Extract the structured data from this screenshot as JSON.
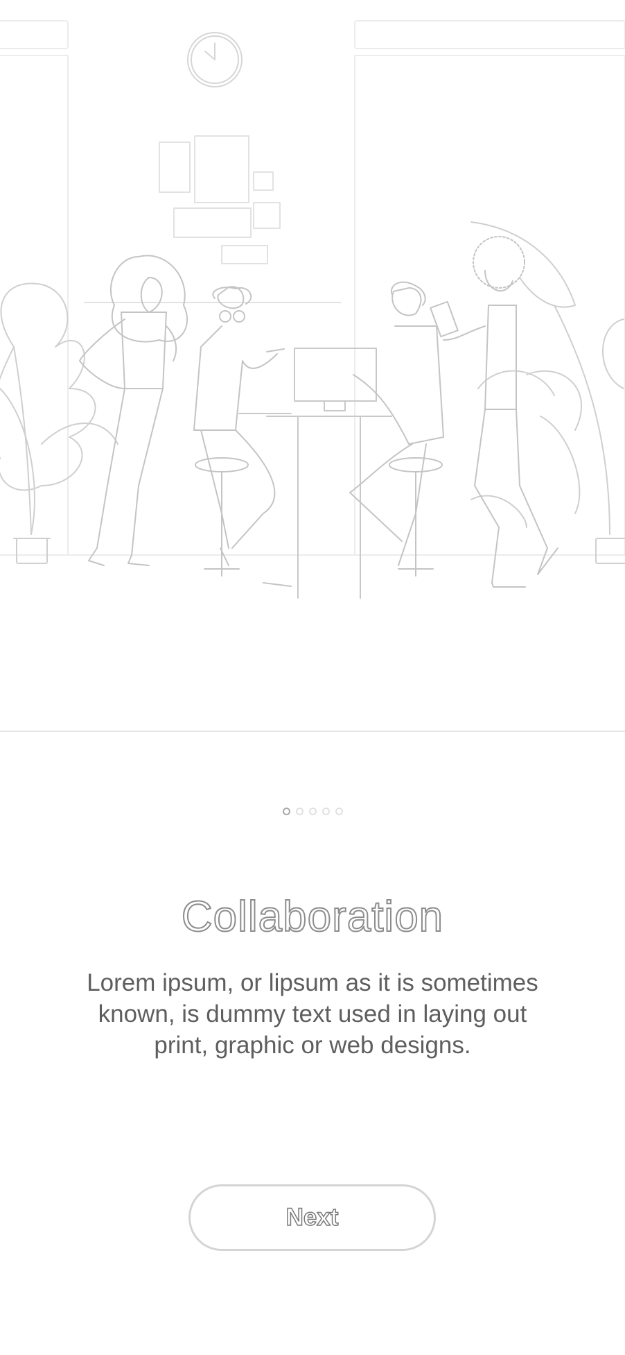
{
  "onboarding": {
    "illustration_icon": "team-collaboration-illustration",
    "pagination": {
      "total": 5,
      "active_index": 1
    },
    "title": "Collaboration",
    "description": "Lorem ipsum, or lipsum as it is sometimes known, is dummy text used in laying out print, graphic or web designs.",
    "next_label": "Next"
  },
  "colors": {
    "background": "#ffffff",
    "line_art": "#bdbdbd",
    "text": "#5e5e5e"
  }
}
